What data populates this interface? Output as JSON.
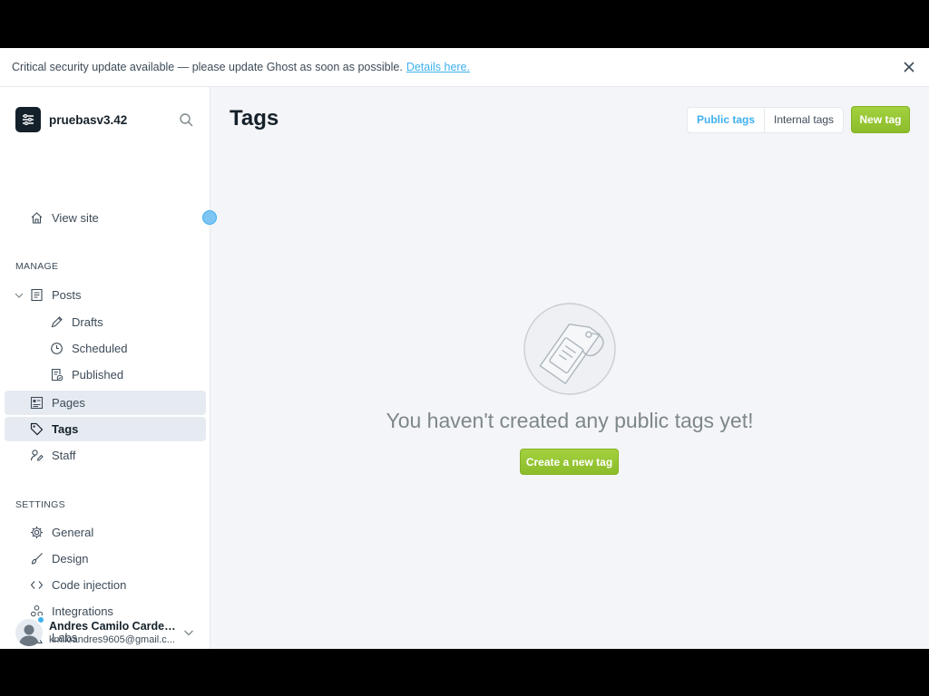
{
  "banner": {
    "message": "Critical security update available — please update Ghost as soon as possible.",
    "link_text": "Details here."
  },
  "sidebar": {
    "site_title": "pruebasv3.42",
    "view_site": "View site",
    "manage_title": "MANAGE",
    "manage_items": [
      {
        "label": "Posts",
        "icon": "posts-icon"
      },
      {
        "label": "Drafts",
        "icon": "pencil-icon"
      },
      {
        "label": "Scheduled",
        "icon": "clock-icon"
      },
      {
        "label": "Published",
        "icon": "published-icon"
      },
      {
        "label": "Pages",
        "icon": "pages-icon"
      },
      {
        "label": "Tags",
        "icon": "tag-icon"
      },
      {
        "label": "Staff",
        "icon": "staff-icon"
      }
    ],
    "settings_title": "SETTINGS",
    "settings_items": [
      {
        "label": "General",
        "icon": "gear-icon"
      },
      {
        "label": "Design",
        "icon": "brush-icon"
      },
      {
        "label": "Code injection",
        "icon": "code-icon"
      },
      {
        "label": "Integrations",
        "icon": "integrations-icon"
      },
      {
        "label": "Labs",
        "icon": "flask-icon"
      }
    ],
    "user": {
      "name": "Andres Camilo Carden...",
      "email": "kmiloandres9605@gmail.c..."
    }
  },
  "main": {
    "title": "Tags",
    "tabs": [
      "Public tags",
      "Internal tags"
    ],
    "active_tab": "Public tags",
    "new_tag_label": "New tag",
    "empty_message": "You haven't created any public tags yet!",
    "create_label": "Create a new tag"
  },
  "colors": {
    "accent": "#3eb0ef",
    "green": "#9fcc35",
    "active_bg": "#e6ebf1"
  }
}
